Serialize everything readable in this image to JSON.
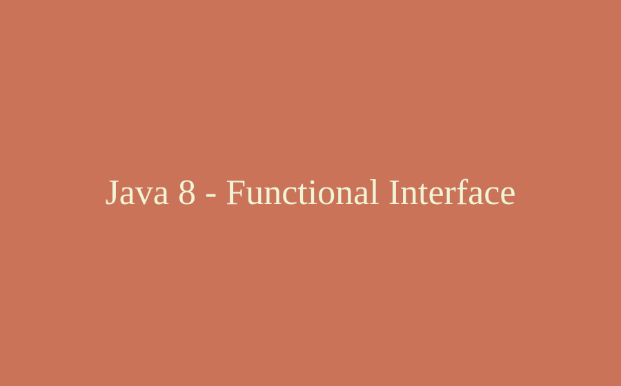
{
  "title": "Java 8 - Functional Interface",
  "colors": {
    "background": "#ca7359",
    "text": "#f0f4d6"
  }
}
